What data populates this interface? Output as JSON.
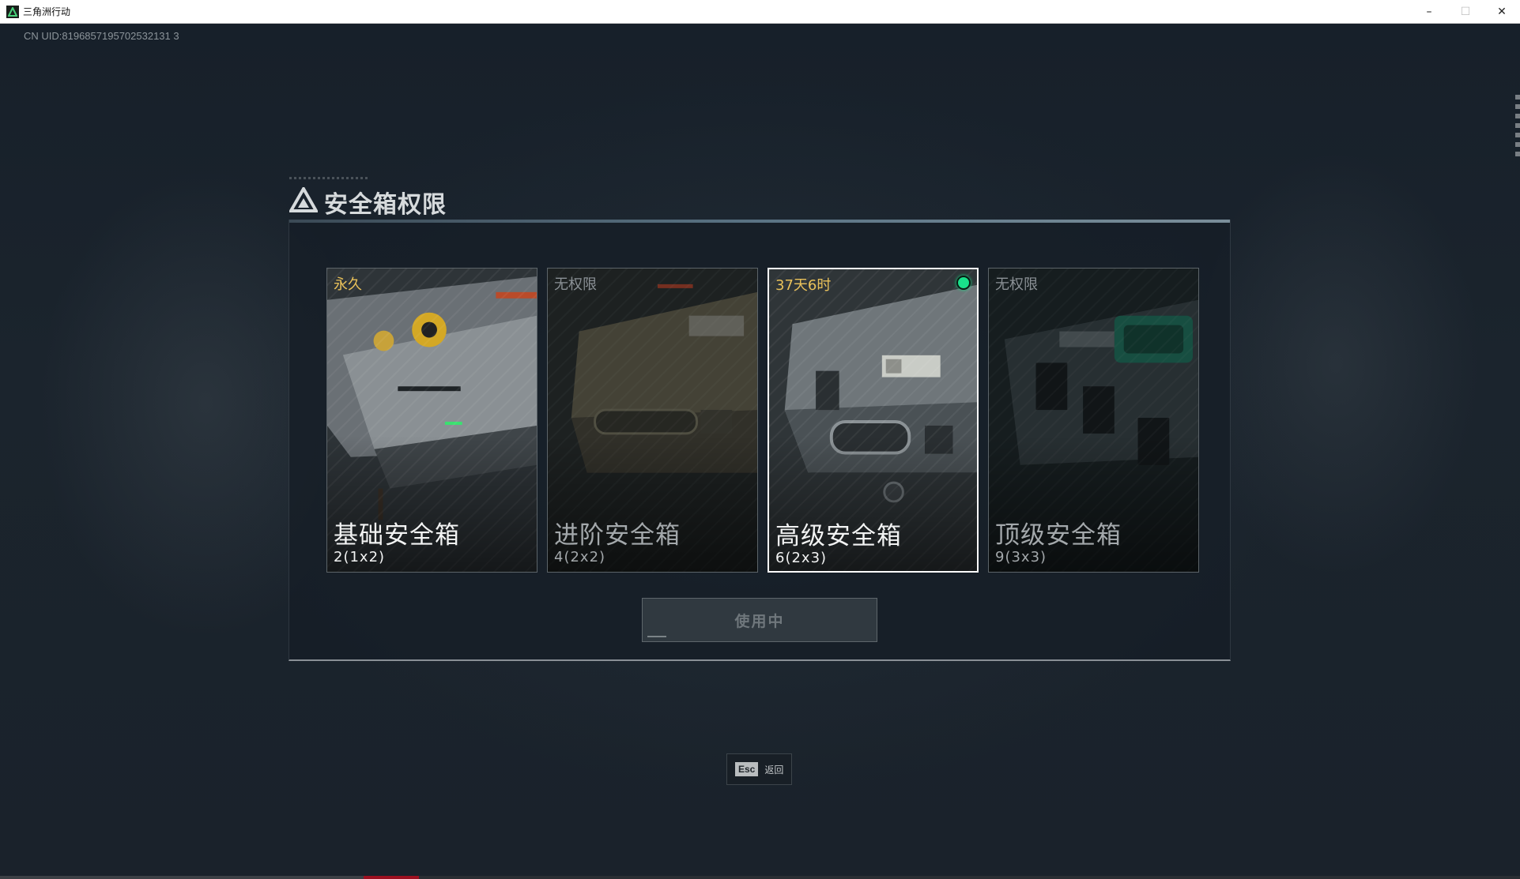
{
  "window": {
    "title": "三角洲行动",
    "controls": {
      "minimize": "–",
      "maximize": "☐",
      "close": "✕"
    }
  },
  "uid_text": "CN UID:8196857195702532131 3",
  "dialog": {
    "title": "安全箱权限",
    "cards": [
      {
        "name": "基础安全箱",
        "capacity": "2(1x2)",
        "status": "永久",
        "status_kind": "owned",
        "selected": false,
        "active": false
      },
      {
        "name": "进阶安全箱",
        "capacity": "4(2x2)",
        "status": "无权限",
        "status_kind": "none",
        "selected": false,
        "active": false
      },
      {
        "name": "高级安全箱",
        "capacity": "6(2x3)",
        "status": "37天6时",
        "status_kind": "owned",
        "selected": true,
        "active": true
      },
      {
        "name": "顶级安全箱",
        "capacity": "9(3x3)",
        "status": "无权限",
        "status_kind": "none",
        "selected": false,
        "active": false
      }
    ],
    "action_button": "使用中"
  },
  "esc_hint": {
    "key": "Esc",
    "label": "返回"
  },
  "colors": {
    "status_owned": "#e9c15a",
    "status_none": "#8b9196",
    "active_indicator": "#19e08a",
    "selected_border": "#ffffff"
  },
  "icons": [
    "app-logo-icon",
    "delta-logo-icon",
    "active-dot-icon"
  ]
}
